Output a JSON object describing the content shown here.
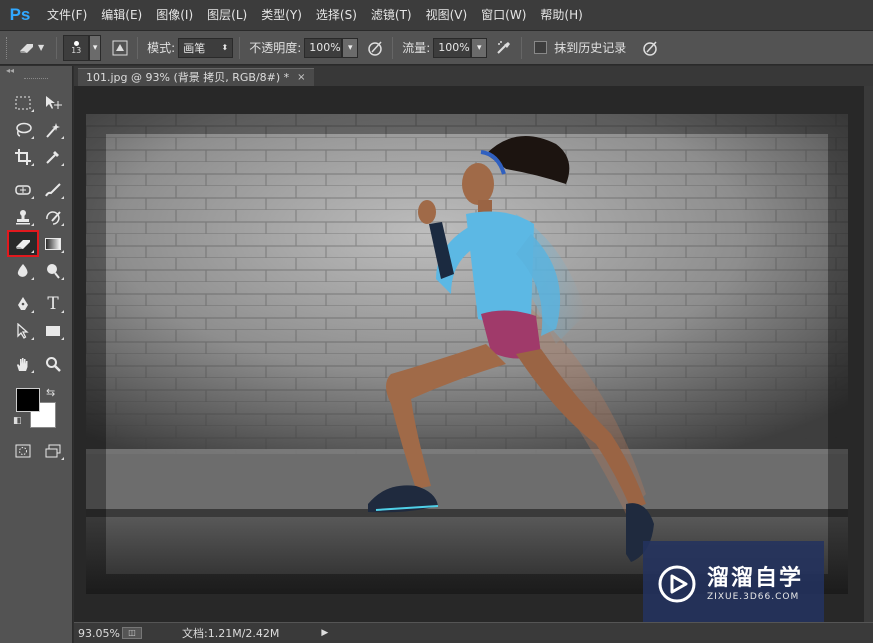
{
  "app": {
    "logo": "Ps",
    "brand_color": "#31a8ff"
  },
  "menu": [
    {
      "label": "文件(F)"
    },
    {
      "label": "编辑(E)"
    },
    {
      "label": "图像(I)"
    },
    {
      "label": "图层(L)"
    },
    {
      "label": "类型(Y)"
    },
    {
      "label": "选择(S)"
    },
    {
      "label": "滤镜(T)"
    },
    {
      "label": "视图(V)"
    },
    {
      "label": "窗口(W)"
    },
    {
      "label": "帮助(H)"
    }
  ],
  "options": {
    "brush_size": "13",
    "mode_label": "模式:",
    "mode_value": "画笔",
    "opacity_label": "不透明度:",
    "opacity_value": "100%",
    "flow_label": "流量:",
    "flow_value": "100%",
    "erase_history_label": "抹到历史记录"
  },
  "tools": {
    "active": "eraser-tool",
    "highlight_color": "#e2191e",
    "foreground_color": "#000000",
    "background_color": "#ffffff"
  },
  "document": {
    "tab_title": "101.jpg @ 93% (背景 拷贝, RGB/8#) *",
    "close_symbol": "×"
  },
  "status": {
    "zoom": "93.05%",
    "doc_info": "文档:1.21M/2.42M"
  },
  "watermark": {
    "title": "溜溜自学",
    "url": "ZIXUE.3D66.COM"
  }
}
